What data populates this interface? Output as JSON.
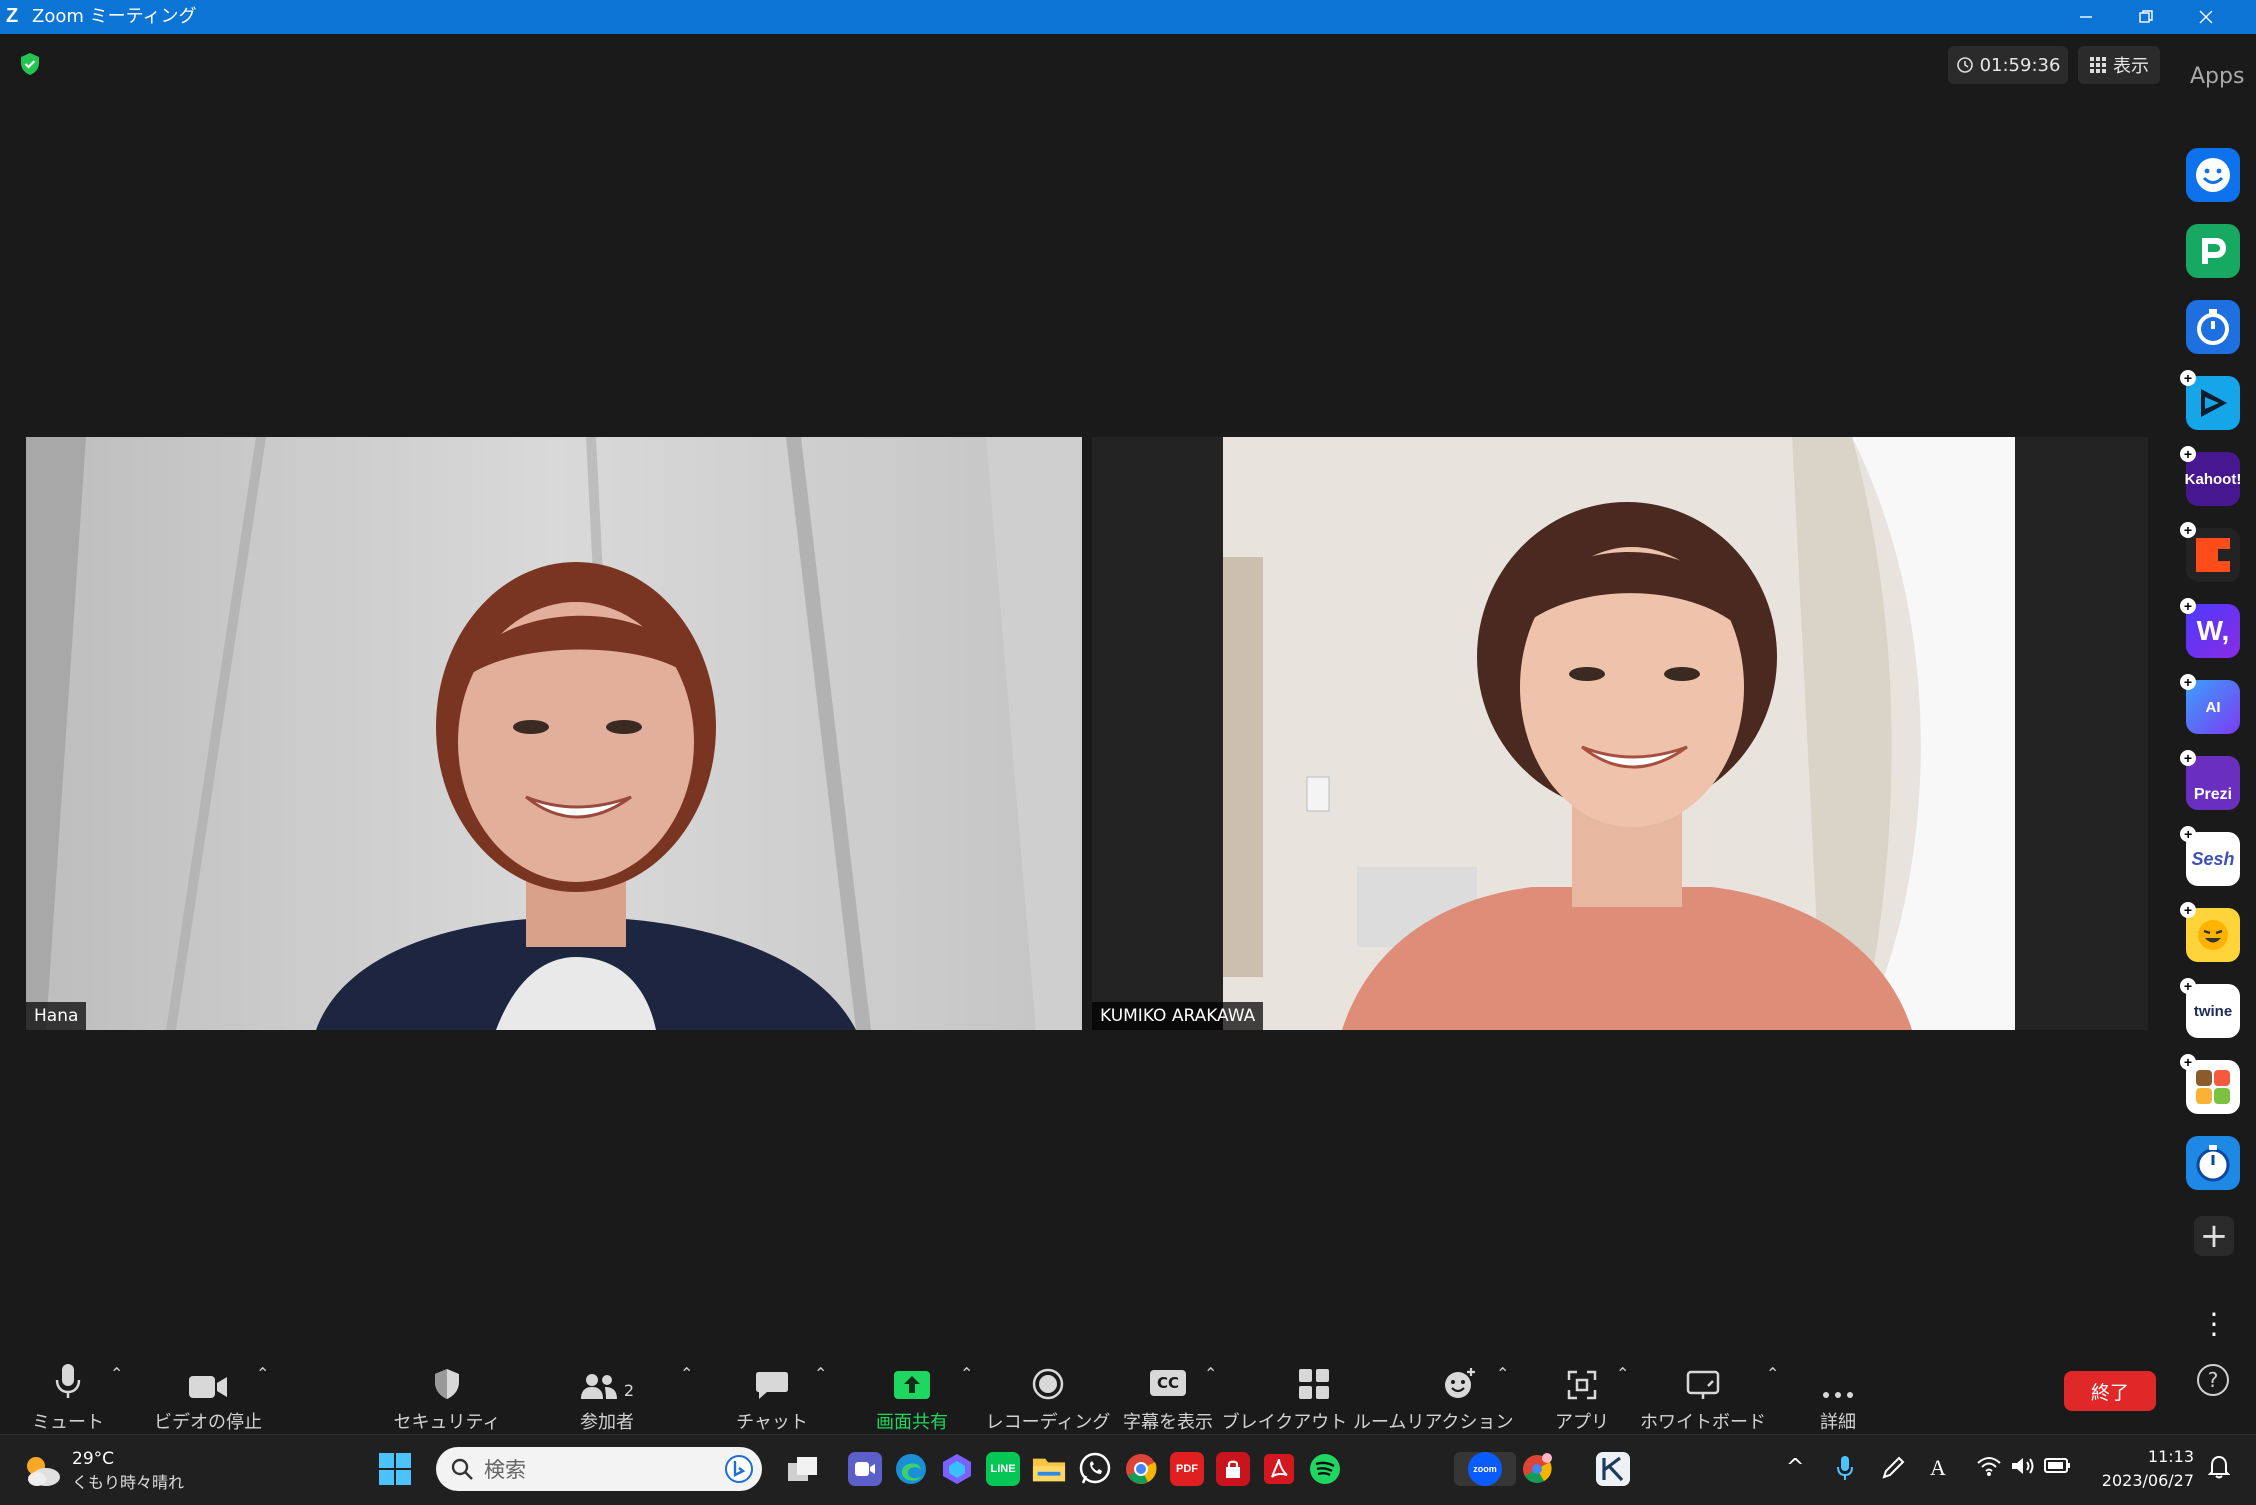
{
  "window": {
    "title": "Zoom ミーティング"
  },
  "meeting": {
    "elapsed": "01:59:36",
    "view_label": "表示",
    "apps_label": "Apps"
  },
  "participants": [
    {
      "name": "Hana"
    },
    {
      "name": "KUMIKO ARAKAWA"
    }
  ],
  "apps": [
    {
      "icon": "emoji-app-icon"
    },
    {
      "icon": "pear-deck-icon"
    },
    {
      "icon": "timer-app-icon"
    },
    {
      "icon": "flip-app-icon"
    },
    {
      "icon": "kahoot-icon",
      "label": "Kahoot!"
    },
    {
      "icon": "c-app-icon"
    },
    {
      "icon": "wooclap-icon",
      "label": "W,"
    },
    {
      "icon": "ai-companion-icon",
      "label": "AI"
    },
    {
      "icon": "prezi-icon",
      "label": "Prezi"
    },
    {
      "icon": "sesh-icon",
      "label": "Sesh"
    },
    {
      "icon": "emoji-game-icon"
    },
    {
      "icon": "twine-icon",
      "label": "twine"
    },
    {
      "icon": "blocks-app-icon"
    },
    {
      "icon": "stopwatch-app-icon"
    }
  ],
  "toolbar": {
    "mute": "ミュート",
    "video": "ビデオの停止",
    "security": "セキュリティ",
    "participants": "参加者",
    "participants_count": "2",
    "chat": "チャット",
    "share": "画面共有",
    "record": "レコーディング",
    "captions": "字幕を表示",
    "captions_badge": "CC",
    "breakout": "ブレイクアウト ルーム",
    "reactions": "リアクション",
    "apps": "アプリ",
    "whiteboard": "ホワイトボード",
    "more": "詳細",
    "end": "終了"
  },
  "taskbar": {
    "temp": "29°C",
    "weather": "くもり時々晴れ",
    "search_placeholder": "検索",
    "time": "11:13",
    "date": "2023/06/27",
    "pdf_label": "PDF",
    "zoom_label": "zoom",
    "line_label": "LINE"
  },
  "colors": {
    "accent": "#0b74d5",
    "share_green": "#1ed760",
    "end_red": "#e02828",
    "secure_green": "#23c552"
  }
}
